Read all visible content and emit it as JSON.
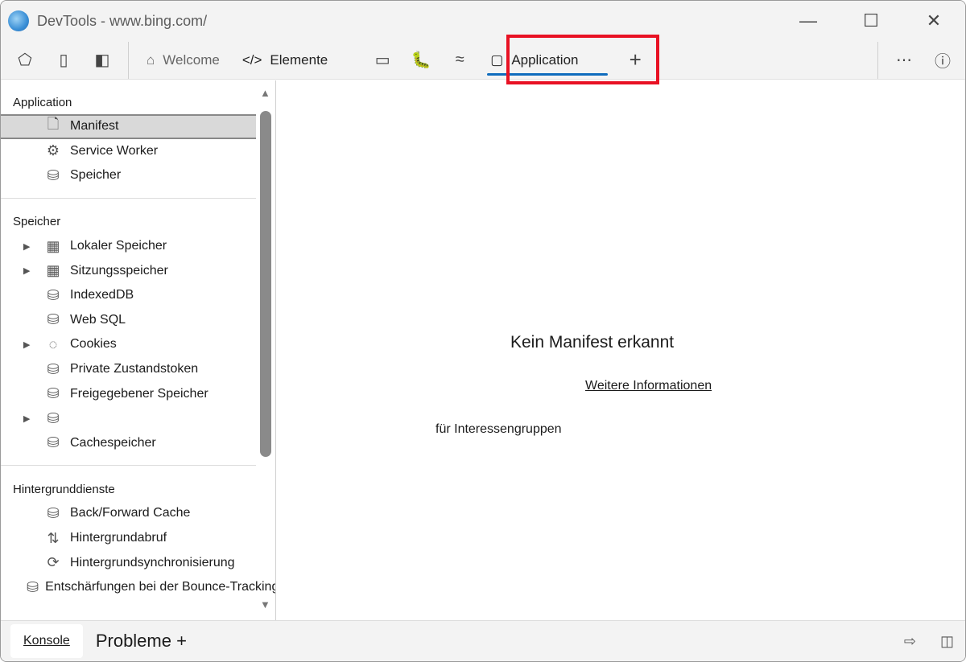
{
  "window": {
    "title": "DevTools - www.bing.com/"
  },
  "toolbar": {
    "tabs": [
      {
        "label": "Welcome"
      },
      {
        "label": "Elemente"
      },
      {
        "label": "Application"
      }
    ],
    "new_tab": "+"
  },
  "sidebar": {
    "sections": [
      {
        "title": "Application",
        "items": [
          {
            "label": "Manifest",
            "icon": "file-icon"
          },
          {
            "label": "Service Worker",
            "icon": "service-worker-icon"
          },
          {
            "label": "Speicher",
            "icon": "database-icon"
          }
        ]
      },
      {
        "title": "Speicher",
        "items": [
          {
            "label": "Lokaler Speicher",
            "icon": "grid-icon",
            "expandable": true
          },
          {
            "label": "Sitzungsspeicher",
            "icon": "grid-icon",
            "expandable": true
          },
          {
            "label": "IndexedDB",
            "icon": "database-icon"
          },
          {
            "label": "Web SQL",
            "icon": "database-icon"
          },
          {
            "label": "Cookies",
            "icon": "cookie-icon",
            "expandable": true
          },
          {
            "label": "Private Zustandstoken",
            "icon": "database-icon"
          },
          {
            "label": "Freigegebener Speicher",
            "icon": "database-icon"
          },
          {
            "label": "",
            "icon": "database-icon",
            "expandable": true
          },
          {
            "label": "Cachespeicher",
            "icon": "database-icon"
          }
        ]
      },
      {
        "title": "Hintergrunddienste",
        "items": [
          {
            "label": "Back/Forward Cache",
            "icon": "database-icon"
          },
          {
            "label": "Hintergrundabruf",
            "icon": "updown-icon"
          },
          {
            "label": "Hintergrundsynchronisierung",
            "icon": "sync-icon"
          },
          {
            "label": "Entschärfungen bei der Bounce-Tracking-Überwachung",
            "icon": "database-icon"
          }
        ]
      }
    ]
  },
  "main": {
    "heading": "Kein Manifest erkannt",
    "link": "Weitere Informationen",
    "extra": "für Interessengruppen"
  },
  "drawer": {
    "tabs": [
      {
        "label": "Konsole"
      },
      {
        "label": "Probleme +"
      }
    ]
  }
}
